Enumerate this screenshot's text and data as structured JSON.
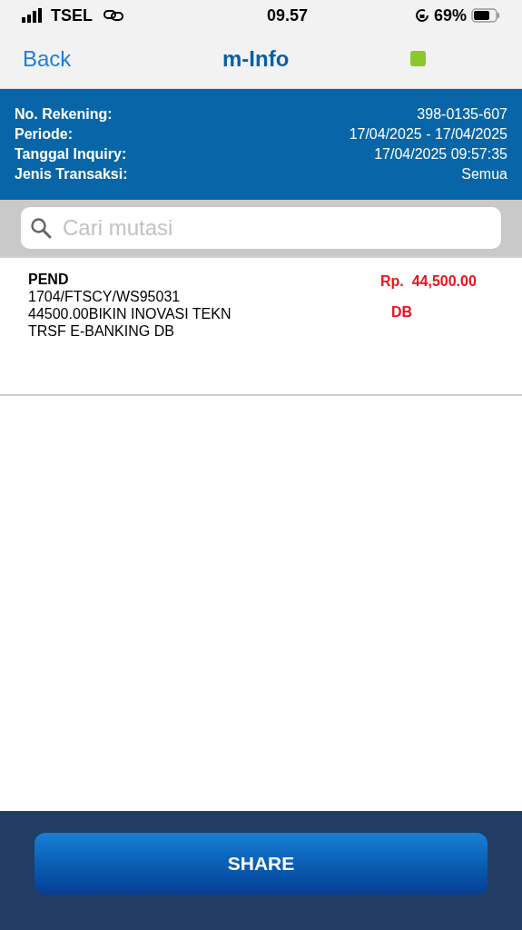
{
  "status_bar": {
    "carrier": "TSEL",
    "time": "09.57",
    "battery": "69%"
  },
  "nav": {
    "back": "Back",
    "title": "m-Info"
  },
  "info": [
    {
      "label": "No. Rekening:",
      "value": "398-0135-607"
    },
    {
      "label": "Periode:",
      "value": "17/04/2025 - 17/04/2025"
    },
    {
      "label": "Tanggal Inquiry:",
      "value": "17/04/2025 09:57:35"
    },
    {
      "label": "Jenis Transaksi:",
      "value": "Semua"
    }
  ],
  "search": {
    "placeholder": "Cari mutasi"
  },
  "transactions": [
    {
      "status": "PEND",
      "lines": [
        "1704/FTSCY/WS95031",
        "44500.00BIKIN INOVASI TEKN",
        "TRSF E-BANKING DB"
      ],
      "amount": "Rp.  44,500.00",
      "type": "DB"
    }
  ],
  "share_button": "SHARE"
}
